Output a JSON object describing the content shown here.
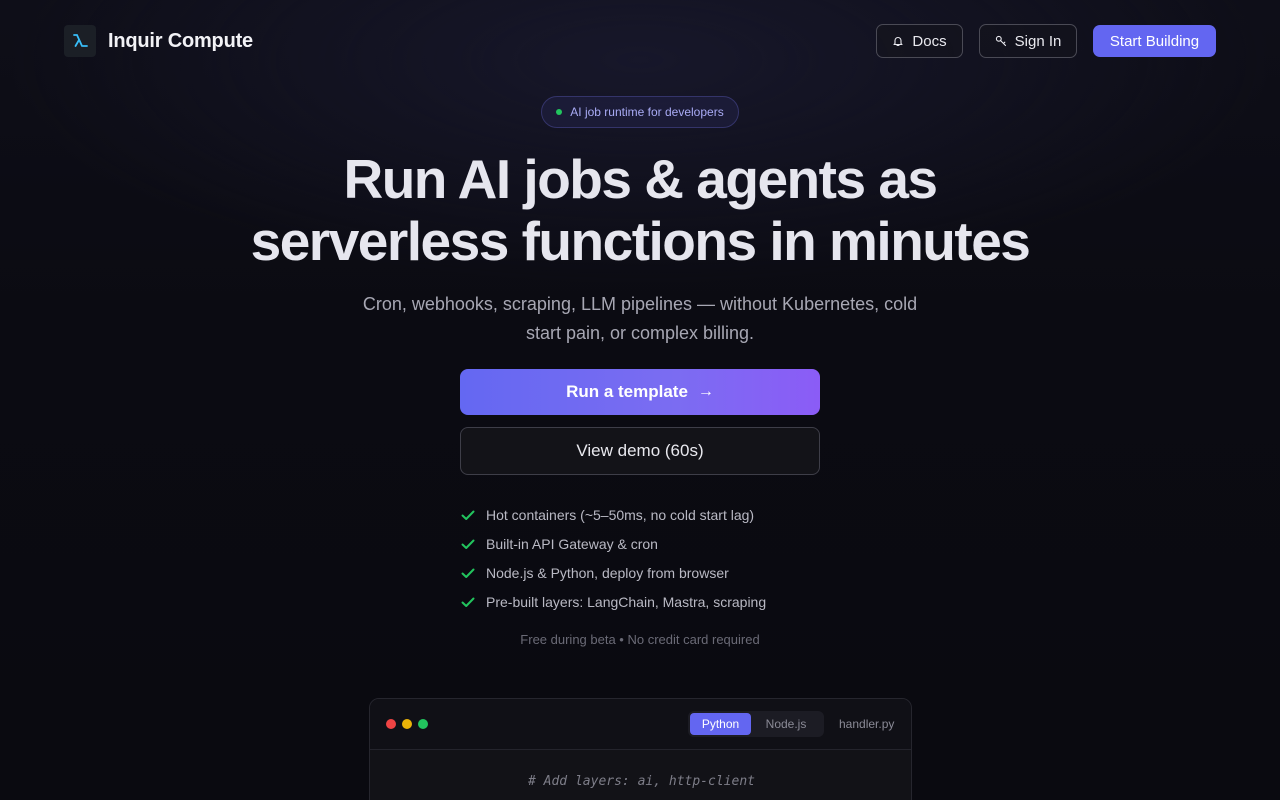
{
  "nav": {
    "logo_icon": "lambda-icon",
    "brand": "Inquir Compute",
    "docs_label": "Docs",
    "docs_icon": "bell-icon",
    "signin_label": "Sign In",
    "signin_icon": "key-icon",
    "start_label": "Start Building"
  },
  "hero": {
    "badge": "AI job runtime for developers",
    "headline_line1": "Run AI jobs & agents as",
    "headline_line2": "serverless functions in minutes",
    "subtext_line1": "Cron, webhooks, scraping, LLM pipelines — without Kubernetes, cold",
    "subtext_line2": "start pain, or complex billing.",
    "cta_primary": "Run a template",
    "cta_primary_arrow": "→",
    "cta_secondary": "View demo (60s)",
    "features": [
      "Hot containers (~5–50ms, no cold start lag)",
      "Built-in API Gateway & cron",
      "Node.js & Python, deploy from browser",
      "Pre-built layers: LangChain, Mastra, scraping"
    ],
    "note": "Free during beta • No credit card required"
  },
  "code": {
    "tabs": [
      "Python",
      "Node.js"
    ],
    "active_tab": "Python",
    "filename": "handler.py",
    "first_line": "# Add layers: ai, http-client"
  },
  "colors": {
    "accent": "#6366f1",
    "accent_purple": "#8b5cf6",
    "check_green": "#22c55e",
    "background": "#0b0b12"
  }
}
